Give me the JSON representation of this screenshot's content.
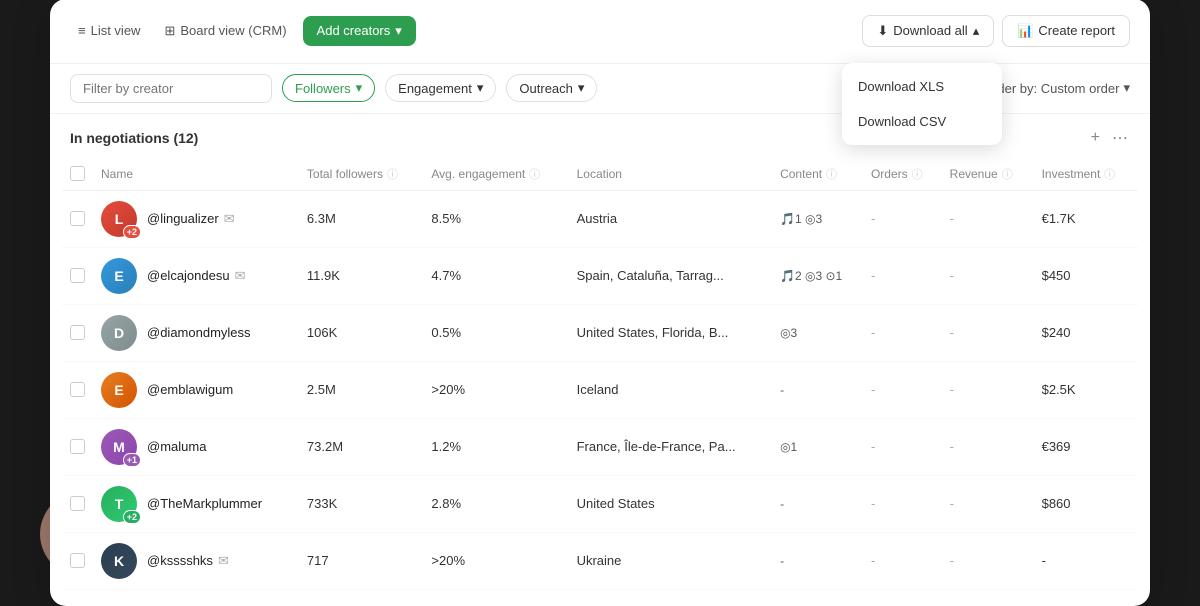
{
  "toolbar": {
    "list_view_label": "List view",
    "board_view_label": "Board view (CRM)",
    "add_creators_label": "Add creators",
    "download_all_label": "Download all",
    "create_report_label": "Create report"
  },
  "filters": {
    "search_placeholder": "Filter by creator",
    "followers_label": "Followers",
    "engagement_label": "Engagement",
    "outreach_label": "Outreach",
    "order_label": "Order by: Custom order"
  },
  "dropdown": {
    "download_xls": "Download XLS",
    "download_csv": "Download CSV"
  },
  "section": {
    "title": "In negotiations (12)",
    "add_icon": "+",
    "more_icon": "⋯"
  },
  "table": {
    "columns": [
      {
        "id": "name",
        "label": "Name"
      },
      {
        "id": "followers",
        "label": "Total followers"
      },
      {
        "id": "engagement",
        "label": "Avg. engagement"
      },
      {
        "id": "location",
        "label": "Location"
      },
      {
        "id": "content",
        "label": "Content"
      },
      {
        "id": "orders",
        "label": "Orders"
      },
      {
        "id": "revenue",
        "label": "Revenue"
      },
      {
        "id": "investment",
        "label": "Investment"
      }
    ],
    "rows": [
      {
        "username": "@lingualizer",
        "has_email": true,
        "badge": "+2",
        "badge_color": "#e74c3c",
        "avatar_class": "av-1",
        "avatar_letter": "L",
        "followers": "6.3M",
        "engagement": "8.5%",
        "location": "Austria",
        "content": "🎵1 ◎3",
        "orders": "-",
        "revenue": "-",
        "investment": "€1.7K"
      },
      {
        "username": "@elcajondesu",
        "has_email": true,
        "badge": "",
        "avatar_class": "av-2",
        "avatar_letter": "E",
        "followers": "11.9K",
        "engagement": "4.7%",
        "location": "Spain, Cataluña, Tarrag...",
        "content": "🎵2 ◎3 ⊙1",
        "orders": "-",
        "revenue": "-",
        "investment": "$450"
      },
      {
        "username": "@diamondmyless",
        "has_email": false,
        "badge": "",
        "avatar_class": "av-3",
        "avatar_letter": "D",
        "followers": "106K",
        "engagement": "0.5%",
        "location": "United States, Florida, B...",
        "content": "◎3",
        "orders": "-",
        "revenue": "-",
        "investment": "$240"
      },
      {
        "username": "@emblawigum",
        "has_email": false,
        "badge": "",
        "avatar_class": "av-4",
        "avatar_letter": "E",
        "followers": "2.5M",
        "engagement": ">20%",
        "location": "Iceland",
        "content": "-",
        "orders": "-",
        "revenue": "-",
        "investment": "$2.5K"
      },
      {
        "username": "@maluma",
        "has_email": false,
        "badge": "+1",
        "badge_color": "#9b59b6",
        "avatar_class": "av-5",
        "avatar_letter": "M",
        "followers": "73.2M",
        "engagement": "1.2%",
        "location": "France, Île-de-France, Pa...",
        "content": "◎1",
        "orders": "-",
        "revenue": "-",
        "investment": "€369"
      },
      {
        "username": "@TheMarkplummer",
        "has_email": false,
        "badge": "+2",
        "badge_color": "#27ae60",
        "avatar_class": "av-6",
        "avatar_letter": "T",
        "followers": "733K",
        "engagement": "2.8%",
        "location": "United States",
        "content": "-",
        "orders": "-",
        "revenue": "-",
        "investment": "$860"
      },
      {
        "username": "@ksssshks",
        "has_email": true,
        "badge": "",
        "avatar_class": "av-7",
        "avatar_letter": "K",
        "followers": "717",
        "engagement": ">20%",
        "location": "Ukraine",
        "content": "-",
        "orders": "-",
        "revenue": "-",
        "investment": "-"
      }
    ]
  }
}
